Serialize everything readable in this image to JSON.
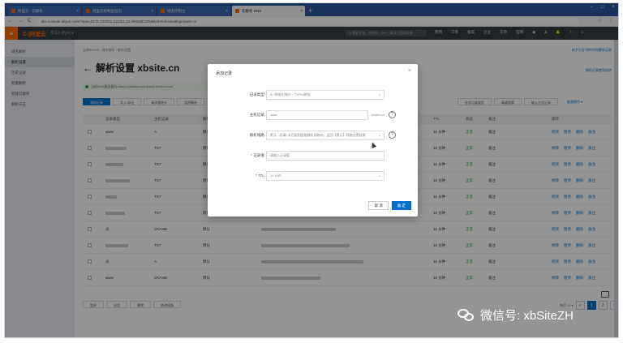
{
  "browser": {
    "tabs": [
      {
        "label": "阿里云 - 云解析"
      },
      {
        "label": "阿里云控制台首页"
      },
      {
        "label": "域名控制台"
      },
      {
        "label": "云解析 DNS",
        "active": true
      }
    ],
    "url": "dns.console.aliyun.com/?spm=5176.100251.111252.34.5f8049f1GRMbUh#/dns/setting/xbsite.cn",
    "nav_back": "←",
    "nav_forward": "→",
    "nav_reload": "C",
    "window_controls": [
      "–",
      "□",
      "×"
    ],
    "bookmark_icon": "☆",
    "menu_icon": "⋮"
  },
  "topnav": {
    "logo": "C-)阿里云",
    "workspace": "华东1 (杭州) ▾",
    "search_placeholder": "Q 搜索文档、控制台、API、解决方案和资源",
    "items": [
      "费用",
      "工单",
      "备案",
      "企业",
      "支持",
      "官网",
      "▣",
      "Д",
      "🔔",
      "?",
      "☺"
    ]
  },
  "sidebar": {
    "items": [
      {
        "label": "域名解析",
        "active": false
      },
      {
        "label": "解析设置",
        "active": true
      },
      {
        "label": "历史记录",
        "active": false
      },
      {
        "label": "批量解析",
        "active": false
      },
      {
        "label": "智能云解析",
        "active": false
      },
      {
        "label": "解析日志",
        "active": false
      }
    ]
  },
  "page": {
    "breadcrumb": "云解析DNS / 域名解析 / 解析设置",
    "title": "解析设置 xbsite.cn",
    "back_arrow": "←",
    "notice": "当前DNS服务器为:dns21.hichina.com,dns22.hichina.com",
    "top_right_link": "新手引导 如何添加解析记录",
    "right_link_2": "解析记录使用说明",
    "buttons": [
      "添加记录",
      "导入/导出",
      "请求量统计",
      "暂停解析"
    ],
    "filter_buttons": [
      "全部记录类型",
      "高级搜索",
      "输入主机记录",
      "批量操作 ▾"
    ],
    "columns": [
      "记录类型",
      "主机记录",
      "解析线路(isp)",
      "记录值",
      "TTL",
      "状态",
      "备注",
      "操作"
    ],
    "rows": [
      {
        "type": "A",
        "host": "www",
        "line": "默认",
        "ttl": "10 分钟",
        "status": "正常"
      },
      {
        "type": "TXT",
        "host": "",
        "line": "默认",
        "ttl": "10 分钟",
        "status": "正常"
      },
      {
        "type": "TXT",
        "host": "",
        "line": "默认",
        "ttl": "10 分钟",
        "status": "正常"
      },
      {
        "type": "TXT",
        "host": "",
        "line": "默认",
        "ttl": "10 分钟",
        "status": "正常"
      },
      {
        "type": "TXT",
        "host": "",
        "line": "默认",
        "ttl": "10 分钟",
        "status": "正常"
      },
      {
        "type": "TXT",
        "host": "",
        "line": "默认",
        "ttl": "10 分钟",
        "status": "正常"
      },
      {
        "type": "CNAME",
        "host": "@",
        "line": "默认",
        "ttl": "10 分钟",
        "status": "正常"
      },
      {
        "type": "TXT",
        "host": "",
        "line": "默认",
        "ttl": "10 分钟",
        "status": "正常"
      },
      {
        "type": "A",
        "host": "@",
        "line": "默认",
        "ttl": "10 分钟",
        "status": "正常"
      },
      {
        "type": "CNAME",
        "host": "www",
        "line": "默认",
        "ttl": "10 分钟",
        "status": "正常"
      }
    ],
    "row_actions": [
      "修改",
      "暂停",
      "删除",
      "备注"
    ],
    "pager_buttons": [
      "暂停",
      "启用",
      "删除",
      "修改线路"
    ],
    "page_size_label": "每页 10 ▾",
    "pages": [
      "<",
      "1",
      "2",
      ">"
    ],
    "current_page": 1
  },
  "modal": {
    "title": "添加记录",
    "close": "×",
    "fields": [
      {
        "label": "记录类型:",
        "value": "A- 将域名指向一个IPV4地址",
        "select": true
      },
      {
        "label": "主机记录:",
        "value": "www",
        "suffix": ".xbsite.cn",
        "help": true
      },
      {
        "label": "解析线路:",
        "value": "默认 - 必填! 未匹配到智能解析线路时，返回【默认】线路设置结果",
        "select": true,
        "help": true
      },
      {
        "label": "* 记录值:",
        "value": "请输入记录值"
      },
      {
        "label": "* TTL:",
        "value": "10 分钟",
        "select": true
      }
    ],
    "cancel": "取 消",
    "confirm": "确 定"
  },
  "watermark": "微信号: xbSiteZH"
}
